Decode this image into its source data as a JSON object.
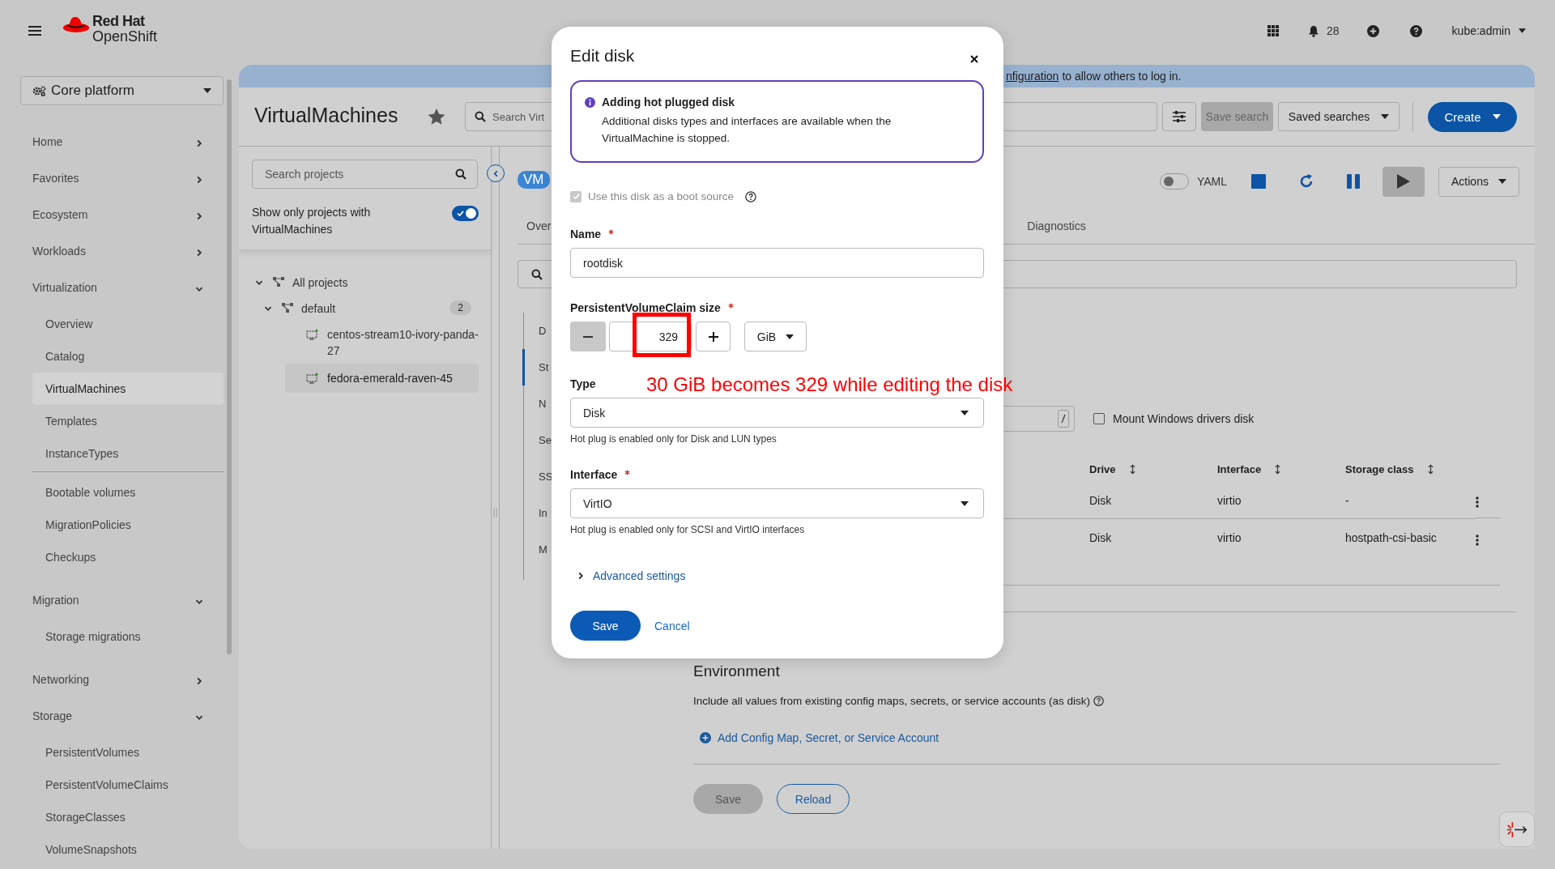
{
  "masthead": {
    "brand_line_1": "Red Hat",
    "brand_line_2": "OpenShift",
    "notification_count": "28",
    "user": "kube:admin"
  },
  "sidebar": {
    "perspective": "Core platform",
    "items": [
      {
        "label": "Home",
        "expanded": false
      },
      {
        "label": "Favorites",
        "expanded": false
      },
      {
        "label": "Ecosystem",
        "expanded": false
      },
      {
        "label": "Workloads",
        "expanded": false
      },
      {
        "label": "Virtualization",
        "expanded": true,
        "children": [
          {
            "kind": "link",
            "label": "Overview",
            "selected": false
          },
          {
            "kind": "link",
            "label": "Catalog",
            "selected": false
          },
          {
            "kind": "link",
            "label": "VirtualMachines",
            "selected": true
          },
          {
            "kind": "link",
            "label": "Templates",
            "selected": false
          },
          {
            "kind": "link",
            "label": "InstanceTypes",
            "selected": false
          },
          {
            "kind": "divider"
          },
          {
            "kind": "link",
            "label": "Bootable volumes",
            "selected": false
          },
          {
            "kind": "link",
            "label": "MigrationPolicies",
            "selected": false
          },
          {
            "kind": "link",
            "label": "Checkups",
            "selected": false
          }
        ]
      },
      {
        "label": "Migration",
        "expanded": true,
        "children": [
          {
            "kind": "link",
            "label": "Storage migrations",
            "selected": false
          }
        ]
      },
      {
        "label": "Networking",
        "expanded": false
      },
      {
        "label": "Storage",
        "expanded": true,
        "children": [
          {
            "kind": "link",
            "label": "PersistentVolumes",
            "selected": false
          },
          {
            "kind": "link",
            "label": "PersistentVolumeClaims",
            "selected": false
          },
          {
            "kind": "link",
            "label": "StorageClasses",
            "selected": false
          },
          {
            "kind": "link",
            "label": "VolumeSnapshots",
            "selected": false
          }
        ]
      }
    ]
  },
  "banner": {
    "link": "nfiguration",
    "text": "to allow others to log in."
  },
  "page": {
    "title": "VirtualMachines",
    "search_placeholder": "Search Virt",
    "save_search": "Save search",
    "saved_searches": "Saved searches",
    "create": "Create"
  },
  "projects": {
    "search_placeholder": "Search projects",
    "filter_label": "Show only projects with VirtualMachines",
    "filter_on": true,
    "tree": [
      {
        "kind": "project",
        "label": "All projects",
        "expanded": true,
        "selected": false,
        "children": [
          {
            "kind": "project",
            "label": "default",
            "expanded": true,
            "selected": false,
            "count": "2",
            "children": [
              {
                "kind": "vm",
                "label": "centos-stream10-ivory-panda-27",
                "selected": false
              },
              {
                "kind": "vm",
                "label": "fedora-emerald-raven-45",
                "selected": true
              }
            ]
          }
        ]
      }
    ]
  },
  "vm": {
    "badge": "VM",
    "yaml_label": "YAML",
    "yaml_on": false,
    "actions": "Actions",
    "tabs": [
      {
        "label": "Over",
        "selected": false
      },
      {
        "label": "Diagnostics",
        "selected": false
      }
    ],
    "sections": [
      {
        "label": "D",
        "selected": false
      },
      {
        "label": "St",
        "selected": true
      },
      {
        "label": "N",
        "selected": false
      },
      {
        "label": "Se",
        "selected": false
      },
      {
        "label": "SS",
        "selected": false
      },
      {
        "label": "In",
        "selected": false
      },
      {
        "label": "M",
        "selected": false
      }
    ],
    "mount_windows_drivers": {
      "label": "Mount Windows drivers disk",
      "checked": false
    },
    "disks": {
      "columns": [
        "Drive",
        "Interface",
        "Storage class"
      ],
      "rows": [
        [
          "Disk",
          "virtio",
          "-"
        ],
        [
          "Disk",
          "virtio",
          "hostpath-csi-basic"
        ]
      ]
    },
    "environment": {
      "title": "Environment",
      "description": "Include all values from existing config maps, secrets, or service accounts (as disk)",
      "add_link": "Add Config Map, Secret, or Service Account",
      "save": "Save",
      "reload": "Reload"
    }
  },
  "dialog": {
    "title": "Edit disk",
    "alert": {
      "title": "Adding hot plugged disk",
      "text": "Additional disks types and interfaces are available when the VirtualMachine is stopped."
    },
    "boot_source": {
      "label": "Use this disk as a boot source",
      "checked": true,
      "disabled": true
    },
    "name": {
      "label": "Name",
      "required": true,
      "value": "rootdisk"
    },
    "size": {
      "label": "PersistentVolumeClaim size",
      "required": true,
      "value": "329",
      "unit": "GiB"
    },
    "type": {
      "label": "Type",
      "required": false,
      "value": "Disk",
      "helper": "Hot plug is enabled only for Disk and LUN types"
    },
    "interface": {
      "label": "Interface",
      "required": true,
      "value": "VirtIO",
      "helper": "Hot plug is enabled only for SCSI and VirtIO interfaces"
    },
    "advanced": {
      "label": "Advanced settings",
      "expanded": false
    },
    "save": "Save",
    "cancel": "Cancel"
  },
  "annotation": {
    "text": "30 GiB becomes 329 while editing the disk"
  }
}
